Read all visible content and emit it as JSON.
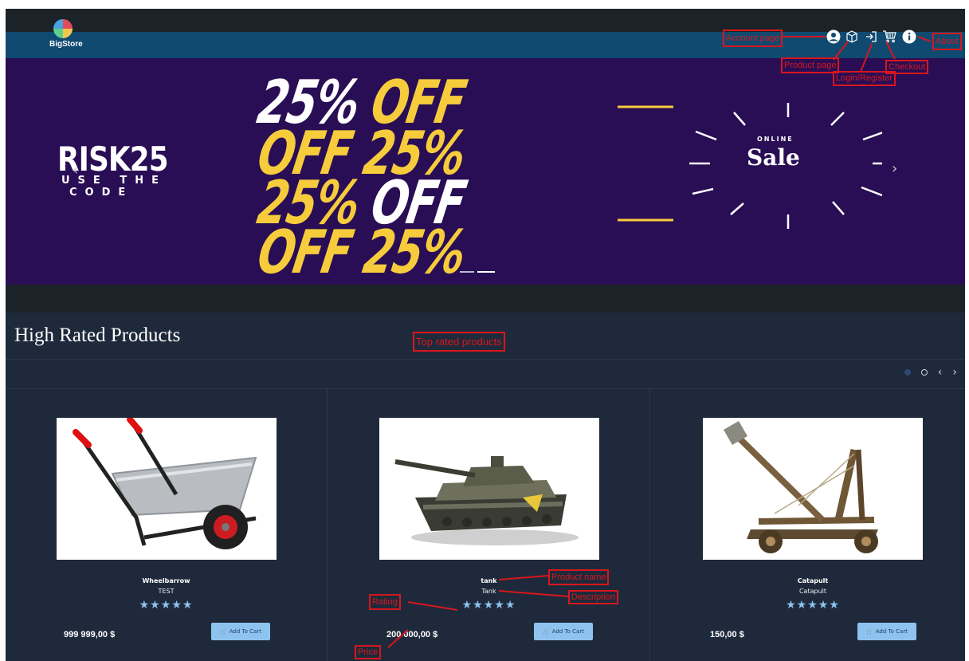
{
  "header": {
    "logo_text": "BigStore",
    "nav_icons": [
      "account-icon",
      "product-box-icon",
      "login-icon",
      "cart-icon",
      "info-icon"
    ]
  },
  "banner": {
    "code_word": "RISK25",
    "code_sub_1": "USE THE",
    "code_sub_2": "CODE",
    "promo_lines": [
      {
        "a": "25%",
        "b": "OFF"
      },
      {
        "a": "OFF",
        "b": "25%"
      },
      {
        "a": "25%",
        "b": "OFF"
      },
      {
        "a": "OFF",
        "b": "25%"
      }
    ],
    "online_text": "ONLINE",
    "sale_text": "Sale",
    "prev_chevron": "‹",
    "next_chevron": "›"
  },
  "section": {
    "title": "High Rated Products"
  },
  "products": [
    {
      "name": "Wheelbarrow",
      "description": "TEST",
      "rating": 5,
      "price": "999 999,00 $",
      "button": "Add To Cart"
    },
    {
      "name": "tank",
      "description": "Tank",
      "rating": 5,
      "price": "200 000,00 $",
      "button": "Add To Cart"
    },
    {
      "name": "Catapult",
      "description": "Catapult",
      "rating": 5,
      "price": "150,00 $",
      "button": "Add To Cart"
    }
  ],
  "annotations": {
    "account": "Account page",
    "product": "Product page",
    "login": "Login/Register",
    "checkout": "Checkout",
    "about": "About",
    "top_rated": "Top rated products",
    "product_name": "Product name",
    "description": "Description",
    "rating": "Rating",
    "price": "Price"
  },
  "colors": {
    "header": "#104a70",
    "banner": "#290e55",
    "section": "#1e2a3b",
    "star": "#8fc3ef",
    "annotation": "#d8161c"
  }
}
